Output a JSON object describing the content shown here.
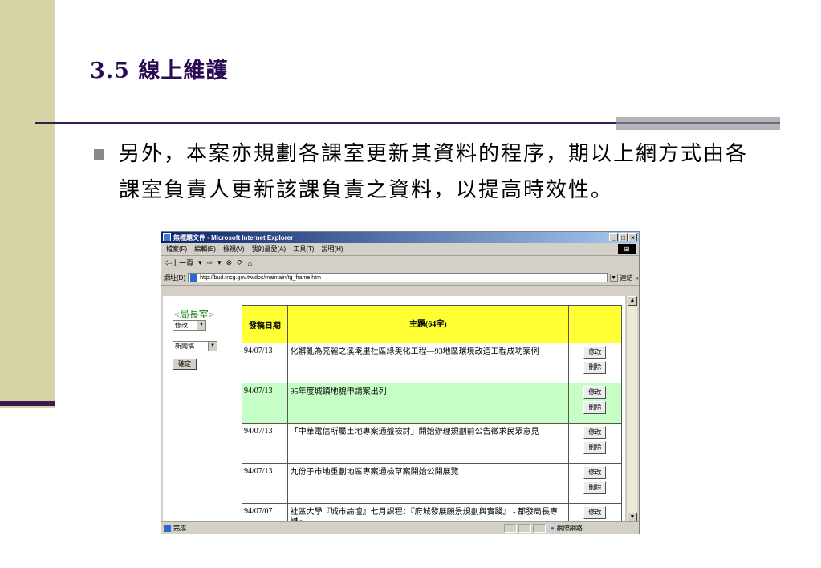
{
  "slide": {
    "title": "3.5 線上維護",
    "bullet": "另外，本案亦規劃各課室更新其資料的程序，期以上網方式由各課室負責人更新該課負責之資料，以提高時效性。"
  },
  "browser": {
    "window_title": "無標題文件 - Microsoft Internet Explorer",
    "window_buttons": [
      "_",
      "□",
      "×"
    ],
    "menu": [
      "檔案(F)",
      "編輯(E)",
      "檢視(V)",
      "我的最愛(A)",
      "工具(T)",
      "說明(H)"
    ],
    "toolbar": {
      "back": "⇦上一頁",
      "back_arrow": "▾",
      "forward": "⇨",
      "forward_arrow": "▾",
      "stop": "⊗",
      "refresh": "⟳",
      "home": "⌂"
    },
    "address_label": "網址(D)",
    "url": "http://bud.tncg.gov.tw/doc/maintain/tg_frame.htm",
    "go_label": "連結",
    "go_more": "»",
    "status_text": "完成",
    "zone_text": "網際網路",
    "logo": "ie-flag-icon"
  },
  "panel": {
    "dept": "<局長室>",
    "action_select": "修改",
    "category_select": "新聞稿",
    "confirm_label": "確定"
  },
  "table": {
    "headers": {
      "date": "發稿日期",
      "subject": "主題(64字)",
      "actions": ""
    },
    "rows": [
      {
        "date": "94/07/13",
        "subject": "化髒亂為亮麗之溪墘里社區綠美化工程—93地區環境改造工程成功案例",
        "edit": "修改",
        "delete": "刪除"
      },
      {
        "date": "94/07/13",
        "subject": "95年度城鎮地貌申請案出列",
        "edit": "修改",
        "delete": "刪除"
      },
      {
        "date": "94/07/13",
        "subject": "「中華電信所屬土地專案通盤檢討」開始辦理規劃前公告徵求民眾意見",
        "edit": "修改",
        "delete": "刪除"
      },
      {
        "date": "94/07/13",
        "subject": "九份子市地重劃地區專案通檢草案開始公開展覽",
        "edit": "修改",
        "delete": "刪除"
      },
      {
        "date": "94/07/07",
        "subject": "社區大學『城市論壇』七月課程：『府城發展願景規劃與實踐』 - 都發局長專講』",
        "edit": "修改",
        "delete": ""
      }
    ]
  },
  "colors": {
    "sidebar": "#d6d3a4",
    "title": "#2a0a55",
    "header_bg": "#ffff33",
    "highlight_row": "#c6ffc6",
    "dept_label": "#118011"
  }
}
